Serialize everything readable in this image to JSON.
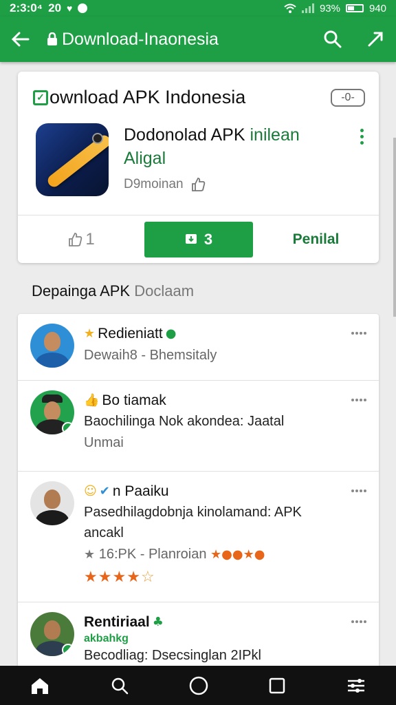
{
  "status_bar": {
    "time": "2:3:0⁴",
    "left_extra": "20",
    "battery_pct": "93%",
    "right_extra": "940",
    "colors": {
      "bar": "#1e9e45"
    }
  },
  "app_bar": {
    "title": "Download-Inaonesia"
  },
  "card": {
    "title": "ownload APK Indonesia",
    "toggle_label": "-0-",
    "app": {
      "name_line1": "Dodonolad APK",
      "name_line1_accent": "inilean",
      "name_line2": "Aligal",
      "meta": "D9moinan"
    },
    "actions": {
      "left_label": "1",
      "main_label": "3",
      "right_label": "Penilal"
    }
  },
  "section": {
    "title": "Depainga APK",
    "title_muted": "Doclaam"
  },
  "list": [
    {
      "title": "Redieniatt",
      "subtitle": "Dewaih8 - Bhemsitaly"
    },
    {
      "title": "Bo tiamak",
      "text": "Baochilinga Nok akondea: Jaatal",
      "subtitle": "Unmai"
    },
    {
      "title": "n Paaiku",
      "text": "Pasedhilagdobnja kinolamand: APK",
      "text2": "ancakl",
      "rating_line": "16:PK - Planroian",
      "rating": 4
    },
    {
      "title": "Rentiriaal",
      "green_sub": "akbahkg",
      "text": "Becodliag: Dsecsinglan 2IPkl"
    }
  ]
}
